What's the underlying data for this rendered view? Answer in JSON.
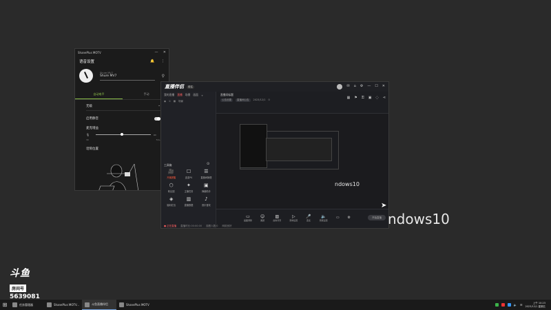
{
  "window_a": {
    "title": "ShanePlus MOTV",
    "header": "语音设置",
    "device_sub": "Shure MV7",
    "device_name": "Shure MV7",
    "tabs": [
      "自动电平",
      "手动"
    ],
    "select_value": "无级",
    "mute_label": "启用静音",
    "gain_label": "麦克增益",
    "tick_left": "30",
    "tick_right": "50+",
    "position_label": "话筒位置",
    "gain_fraction": 0.45
  },
  "window_b": {
    "logo": "直播伴侣",
    "badge": "前往",
    "left_tabs": [
      "我的直播",
      "直播",
      "场景",
      "画面"
    ],
    "left_tools": [
      "场景"
    ],
    "tools_header": "工具箱",
    "tools": [
      {
        "label": "开播提醒",
        "icon": "🎥",
        "active": true
      },
      {
        "label": "连麦PK",
        "icon": "☐"
      },
      {
        "label": "直播间管理",
        "icon": "☰"
      },
      {
        "label": "粉丝团",
        "icon": "⬡"
      },
      {
        "label": "主播任务",
        "icon": "✦"
      },
      {
        "label": "弹幕助手",
        "icon": "▣"
      },
      {
        "label": "福利红包",
        "icon": "◈"
      },
      {
        "label": "直播数据",
        "icon": "▥"
      },
      {
        "label": "音乐音效",
        "icon": "♪"
      }
    ],
    "info_title": "直播间标题",
    "info_pills": [
      "公告设置",
      "直播间公告",
      "2023/12/1",
      "0"
    ],
    "preview_text": "ndows10",
    "bottom_buttons": [
      "画面调整",
      "美颜",
      "虚拟背景",
      "音效设置",
      "连麦",
      "音频设置"
    ],
    "golive": "开始直播",
    "status": [
      "● 正在直播",
      "直播时长:00:00:00",
      "观看人数:0",
      "网络良好"
    ]
  },
  "desktop_text": "ndows10",
  "room_logo": {
    "a": "斗鱼",
    "b": "房间号",
    "c": "5639081"
  },
  "taskbar": {
    "items": [
      {
        "label": "任务管理器",
        "active": false
      },
      {
        "label": "ShanePlus MOTV...",
        "active": false
      },
      {
        "label": "斗鱼直播伴侣",
        "active": true
      },
      {
        "label": "ShanePlus MOTV",
        "active": false
      }
    ],
    "time": "上午 10:23",
    "date": "2023/12/1 星期五"
  }
}
